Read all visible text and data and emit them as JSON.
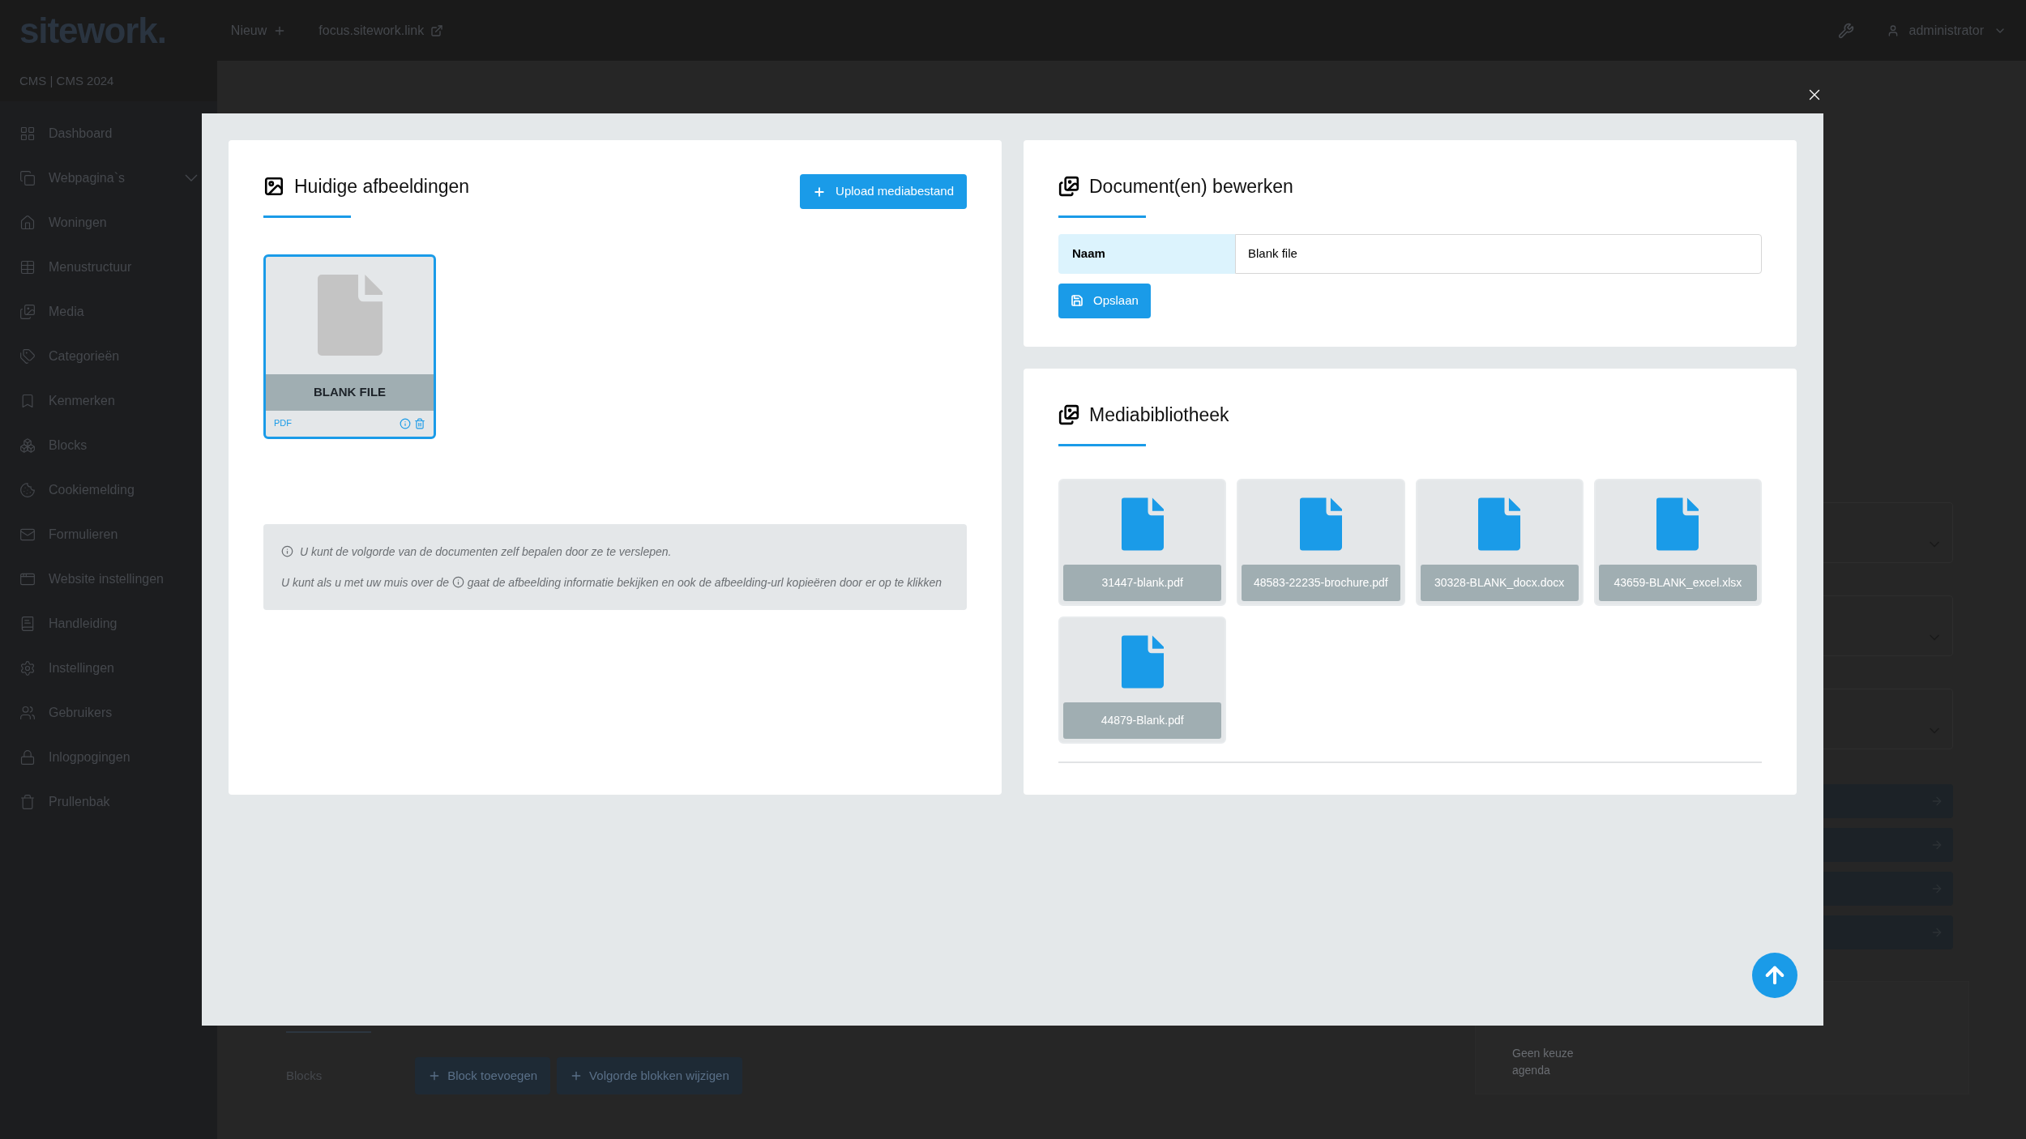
{
  "top_bar": {
    "logo": "sitework.",
    "links": [
      "Nieuw",
      "focus.sitework.link"
    ],
    "user": "administrator"
  },
  "sidebar": {
    "title": "CMS | CMS 2024",
    "items": [
      {
        "label": "Dashboard",
        "has_submenu": false
      },
      {
        "label": "Webpagina`s",
        "has_submenu": true
      },
      {
        "label": "Woningen",
        "has_submenu": false
      },
      {
        "label": "Menustructuur",
        "has_submenu": false
      },
      {
        "label": "Media",
        "has_submenu": false
      },
      {
        "label": "Categorieën",
        "has_submenu": false
      },
      {
        "label": "Kenmerken",
        "has_submenu": false
      },
      {
        "label": "Blocks",
        "has_submenu": false
      },
      {
        "label": "Cookiemelding",
        "has_submenu": false
      },
      {
        "label": "Formulieren",
        "has_submenu": false
      },
      {
        "label": "Website instellingen",
        "has_submenu": false
      },
      {
        "label": "Handleiding",
        "has_submenu": false
      },
      {
        "label": "Instellingen",
        "has_submenu": false
      },
      {
        "label": "Gebruikers",
        "has_submenu": false
      },
      {
        "label": "Inlogpogingen",
        "has_submenu": false
      },
      {
        "label": "Prullenbak",
        "has_submenu": false
      }
    ]
  },
  "background": {
    "blocks_label": "Blocks",
    "buttons": [
      "Block toevoegen",
      "Volgorde blokken wijzigen"
    ],
    "agenda_note": "Geen keuze agenda"
  },
  "modal": {
    "current": {
      "title": "Huidige afbeeldingen",
      "upload_button": "Upload mediabestand",
      "files": [
        {
          "name": "BLANK FILE",
          "type": "PDF",
          "selected": true
        }
      ],
      "tip_1": "U kunt de volgorde van de documenten zelf bepalen door ze te verslepen.",
      "tip_2_before": "U kunt als u met uw muis over de",
      "tip_2_after": "gaat de afbeelding informatie bekijken en ook de afbeelding-url kopieëren door er op te klikken"
    },
    "edit": {
      "title": "Document(en) bewerken",
      "fields": [
        {
          "label": "Naam",
          "value": "Blank file"
        }
      ],
      "save_button": "Opslaan"
    },
    "library": {
      "title": "Mediabibliotheek",
      "files": [
        "31447-blank.pdf",
        "48583-22235-brochure.pdf",
        "30328-BLANK_docx.docx",
        "43659-BLANK_excel.xlsx",
        "44879-Blank.pdf"
      ]
    }
  }
}
